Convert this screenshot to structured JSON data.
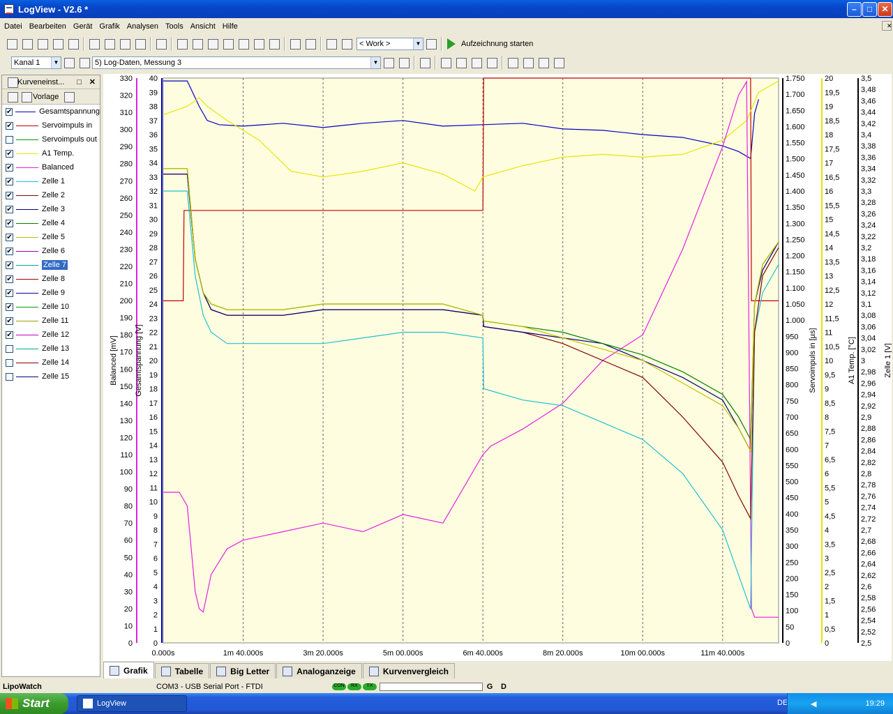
{
  "window": {
    "title": "LogView - V2.6 *"
  },
  "menu": [
    "Datei",
    "Bearbeiten",
    "Gerät",
    "Grafik",
    "Analysen",
    "Tools",
    "Ansicht",
    "Hilfe"
  ],
  "toolbar1": {
    "profile_combo": "< Work >",
    "record_button": "Aufzeichnung starten"
  },
  "toolbar2": {
    "channel_combo": "Kanal 1",
    "log_combo": "5) Log-Daten, Messung 3"
  },
  "left_panel": {
    "title": "Kurveneinst...",
    "template_label": "Vorlage",
    "curves": [
      {
        "label": "Gesamtspannung",
        "checked": true,
        "color": "#0000c0"
      },
      {
        "label": "Servoimpuls in",
        "checked": true,
        "color": "#b00000"
      },
      {
        "label": "Servoimpuls out",
        "checked": false,
        "color": "#00a000"
      },
      {
        "label": "A1 Temp.",
        "checked": true,
        "color": "#e6e600"
      },
      {
        "label": "Balanced",
        "checked": true,
        "color": "#e020e0"
      },
      {
        "label": "Zelle 1",
        "checked": true,
        "color": "#20c0d0"
      },
      {
        "label": "Zelle 2",
        "checked": true,
        "color": "#800000"
      },
      {
        "label": "Zelle 3",
        "checked": true,
        "color": "#000080"
      },
      {
        "label": "Zelle 4",
        "checked": true,
        "color": "#008000"
      },
      {
        "label": "Zelle 5",
        "checked": true,
        "color": "#c0c000"
      },
      {
        "label": "Zelle 6",
        "checked": true,
        "color": "#a000a0"
      },
      {
        "label": "Zelle 7",
        "checked": true,
        "color": "#00a0a0",
        "selected": true
      },
      {
        "label": "Zelle 8",
        "checked": true,
        "color": "#a00000"
      },
      {
        "label": "Zelle 9",
        "checked": true,
        "color": "#0000a0"
      },
      {
        "label": "Zelle 10",
        "checked": true,
        "color": "#00a000"
      },
      {
        "label": "Zelle 11",
        "checked": true,
        "color": "#a0a000"
      },
      {
        "label": "Zelle 12",
        "checked": true,
        "color": "#c000c0"
      },
      {
        "label": "Zelle 13",
        "checked": false,
        "color": "#00a0a0"
      },
      {
        "label": "Zelle 14",
        "checked": false,
        "color": "#800000"
      },
      {
        "label": "Zelle 15",
        "checked": false,
        "color": "#000080"
      }
    ]
  },
  "tabs": [
    "Grafik",
    "Tabelle",
    "Big Letter",
    "Analoganzeige",
    "Kurvenvergleich"
  ],
  "status": {
    "app": "LipoWatch",
    "port": "COM3 - USB Serial Port - FTDI",
    "leds": [
      "CON",
      "RX",
      "TX"
    ],
    "g": "G",
    "d": "D"
  },
  "taskbar": {
    "start": "Start",
    "task": "LogView",
    "lang": "DE",
    "time": "19:29"
  },
  "chart_data": {
    "type": "line",
    "x_ticks": [
      "0.000s",
      "1m 40.000s",
      "3m 20.000s",
      "5m 00.000s",
      "6m 40.000s",
      "8m 20.000s",
      "10m 00.000s",
      "11m 40.000s"
    ],
    "xlim_s": [
      0,
      770
    ],
    "axes": [
      {
        "label": "Balanced [mV]",
        "min": 0,
        "max": 330,
        "ticks": [
          "0",
          "10",
          "20",
          "30",
          "40",
          "50",
          "60",
          "70",
          "80",
          "90",
          "100",
          "110",
          "120",
          "130",
          "140",
          "150",
          "160",
          "170",
          "180",
          "190",
          "200",
          "210",
          "220",
          "230",
          "240",
          "250",
          "260",
          "270",
          "280",
          "290",
          "300",
          "310",
          "320",
          "330"
        ]
      },
      {
        "label": "Gesamtspannung [V]",
        "min": 0,
        "max": 40,
        "ticks": [
          "0",
          "1",
          "2",
          "3",
          "4",
          "5",
          "6",
          "7",
          "8",
          "9",
          "10",
          "11",
          "12",
          "13",
          "14",
          "15",
          "16",
          "17",
          "18",
          "19",
          "20",
          "21",
          "22",
          "23",
          "24",
          "25",
          "26",
          "27",
          "28",
          "29",
          "30",
          "31",
          "32",
          "33",
          "34",
          "35",
          "36",
          "37",
          "38",
          "39",
          "40"
        ]
      },
      {
        "label": "Servoimpuls in [µs]",
        "min": 0,
        "max": 1750,
        "ticks": [
          "0",
          "50",
          "100",
          "150",
          "200",
          "250",
          "300",
          "350",
          "400",
          "450",
          "500",
          "550",
          "600",
          "650",
          "700",
          "750",
          "800",
          "850",
          "900",
          "950",
          "1.000",
          "1.050",
          "1.100",
          "1.150",
          "1.200",
          "1.250",
          "1.300",
          "1.350",
          "1.400",
          "1.450",
          "1.500",
          "1.550",
          "1.600",
          "1.650",
          "1.700",
          "1.750"
        ]
      },
      {
        "label": "A1 Temp. [°C]",
        "min": 0,
        "max": 20,
        "ticks": [
          "0",
          "0,5",
          "1",
          "1,5",
          "2",
          "2,5",
          "3",
          "3,5",
          "4",
          "4,5",
          "5",
          "5,5",
          "6",
          "6,5",
          "7",
          "7,5",
          "8",
          "8,5",
          "9",
          "9,5",
          "10",
          "10,5",
          "11",
          "11,5",
          "12",
          "12,5",
          "13",
          "13,5",
          "14",
          "14,5",
          "15",
          "15,5",
          "16",
          "16,5",
          "17",
          "17,5",
          "18",
          "18,5",
          "19",
          "19,5",
          "20"
        ]
      },
      {
        "label": "Zelle 1 [V]",
        "min": 2.5,
        "max": 3.5,
        "ticks": [
          "2,5",
          "2,52",
          "2,54",
          "2,56",
          "2,58",
          "2,6",
          "2,62",
          "2,64",
          "2,66",
          "2,68",
          "2,7",
          "2,72",
          "2,74",
          "2,76",
          "2,78",
          "2,8",
          "2,82",
          "2,84",
          "2,86",
          "2,88",
          "2,9",
          "2,92",
          "2,94",
          "2,96",
          "2,98",
          "3",
          "3,02",
          "3,04",
          "3,06",
          "3,08",
          "3,1",
          "3,12",
          "3,14",
          "3,16",
          "3,18",
          "3,2",
          "3,22",
          "3,24",
          "3,26",
          "3,28",
          "3,3",
          "3,32",
          "3,34",
          "3,36",
          "3,38",
          "3,4",
          "3,42",
          "3,44",
          "3,46",
          "3,48",
          "3,5"
        ]
      }
    ],
    "series": [
      {
        "name": "Gesamtspannung",
        "color": "#0000c0",
        "axis": 1,
        "x": [
          0,
          30,
          45,
          55,
          70,
          100,
          150,
          200,
          250,
          300,
          350,
          400,
          450,
          500,
          550,
          600,
          650,
          700,
          720,
          735,
          740,
          745
        ],
        "y": [
          39.8,
          39.8,
          38,
          37,
          36.7,
          36.6,
          36.8,
          36.5,
          36.8,
          37,
          36.6,
          36.7,
          36.8,
          36.4,
          36.3,
          36,
          35.8,
          35.2,
          34.8,
          34.3,
          37.5,
          38.5
        ]
      },
      {
        "name": "Servoimpuls in",
        "color": "#c00000",
        "axis": 2,
        "x": [
          0,
          25,
          26,
          400,
          401,
          735,
          736,
          745,
          746,
          770
        ],
        "y": [
          1060,
          1060,
          1340,
          1340,
          1750,
          1750,
          1060,
          1060,
          1060,
          1060
        ]
      },
      {
        "name": "A1 Temp.",
        "color": "#e6e600",
        "axis": 3,
        "x": [
          0,
          30,
          45,
          55,
          80,
          120,
          160,
          200,
          250,
          300,
          350,
          390,
          400,
          450,
          500,
          550,
          600,
          650,
          700,
          730,
          745,
          770
        ],
        "y": [
          18.7,
          19,
          19.3,
          19,
          18.5,
          17.8,
          16.7,
          16.5,
          16.7,
          17,
          16.6,
          16,
          16.5,
          16.9,
          17.2,
          17.3,
          17.2,
          17.3,
          17.8,
          18.5,
          19.5,
          19.9
        ]
      },
      {
        "name": "Balanced",
        "color": "#e020e0",
        "axis": 0,
        "x": [
          0,
          20,
          30,
          40,
          45,
          50,
          60,
          80,
          100,
          150,
          200,
          250,
          300,
          350,
          400,
          410,
          450,
          500,
          550,
          600,
          650,
          700,
          720,
          730,
          736,
          740,
          760,
          770
        ],
        "y": [
          88,
          88,
          80,
          30,
          20,
          18,
          40,
          55,
          60,
          65,
          70,
          65,
          75,
          70,
          110,
          115,
          125,
          140,
          165,
          180,
          230,
          290,
          320,
          328,
          20,
          15,
          15,
          15
        ]
      },
      {
        "name": "Zelle 1",
        "color": "#20c0d0",
        "axis": 4,
        "x": [
          0,
          30,
          40,
          50,
          60,
          80,
          100,
          150,
          200,
          250,
          300,
          350,
          400,
          401,
          450,
          500,
          550,
          600,
          650,
          700,
          720,
          735,
          740,
          750,
          770
        ],
        "y": [
          3.3,
          3.3,
          3.15,
          3.08,
          3.05,
          3.03,
          3.03,
          3.03,
          3.03,
          3.04,
          3.05,
          3.05,
          3.04,
          2.95,
          2.93,
          2.92,
          2.89,
          2.86,
          2.8,
          2.7,
          2.62,
          2.56,
          3.05,
          3.12,
          3.17
        ]
      },
      {
        "name": "Zelle 2",
        "color": "#800000",
        "axis": 4,
        "x": [
          0,
          30,
          40,
          50,
          60,
          80,
          100,
          150,
          200,
          250,
          300,
          350,
          400,
          401,
          450,
          500,
          550,
          600,
          650,
          700,
          720,
          735,
          740,
          750,
          770
        ],
        "y": [
          3.33,
          3.33,
          3.18,
          3.12,
          3.09,
          3.08,
          3.08,
          3.08,
          3.09,
          3.09,
          3.09,
          3.09,
          3.08,
          3.06,
          3.05,
          3.03,
          3.0,
          2.97,
          2.9,
          2.82,
          2.76,
          2.72,
          3.05,
          3.15,
          3.2
        ]
      },
      {
        "name": "Zelle 3",
        "color": "#000080",
        "axis": 4,
        "x": [
          0,
          30,
          40,
          50,
          60,
          80,
          100,
          150,
          200,
          250,
          300,
          350,
          400,
          401,
          450,
          500,
          550,
          600,
          650,
          700,
          720,
          735,
          740,
          750,
          770
        ],
        "y": [
          3.33,
          3.33,
          3.18,
          3.12,
          3.09,
          3.08,
          3.08,
          3.08,
          3.09,
          3.09,
          3.09,
          3.09,
          3.08,
          3.06,
          3.05,
          3.04,
          3.03,
          3.0,
          2.97,
          2.93,
          2.88,
          2.84,
          3.1,
          3.16,
          3.21
        ]
      },
      {
        "name": "Zelle 4",
        "color": "#008000",
        "axis": 4,
        "x": [
          0,
          30,
          40,
          50,
          60,
          80,
          100,
          150,
          200,
          250,
          300,
          350,
          400,
          401,
          450,
          500,
          550,
          600,
          650,
          700,
          720,
          735,
          740,
          750,
          770
        ],
        "y": [
          3.34,
          3.34,
          3.18,
          3.12,
          3.1,
          3.09,
          3.09,
          3.09,
          3.1,
          3.1,
          3.1,
          3.1,
          3.08,
          3.07,
          3.06,
          3.05,
          3.03,
          3.01,
          2.98,
          2.94,
          2.9,
          2.86,
          3.1,
          3.17,
          3.21
        ]
      },
      {
        "name": "Zelle 5",
        "color": "#c0c000",
        "axis": 4,
        "x": [
          0,
          30,
          40,
          50,
          60,
          80,
          100,
          150,
          200,
          250,
          300,
          350,
          400,
          401,
          450,
          500,
          550,
          600,
          650,
          700,
          720,
          735,
          740,
          750,
          770
        ],
        "y": [
          3.34,
          3.34,
          3.18,
          3.12,
          3.1,
          3.09,
          3.09,
          3.09,
          3.1,
          3.1,
          3.1,
          3.1,
          3.08,
          3.07,
          3.06,
          3.04,
          3.02,
          3.0,
          2.96,
          2.92,
          2.88,
          2.84,
          3.1,
          3.17,
          3.21
        ]
      }
    ]
  }
}
